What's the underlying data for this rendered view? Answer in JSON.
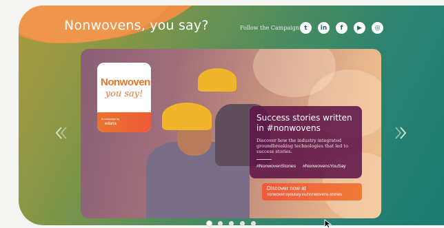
{
  "header": {
    "title": "Nonwovens, you say?",
    "follow_label": "Follow the Campaign",
    "socials": [
      {
        "icon": "twitter-icon",
        "glyph": "t"
      },
      {
        "icon": "linkedin-icon",
        "glyph": "in"
      },
      {
        "icon": "facebook-icon",
        "glyph": "f"
      },
      {
        "icon": "youtube-icon",
        "glyph": "▶"
      },
      {
        "icon": "instagram-icon",
        "glyph": "◎"
      }
    ]
  },
  "slide": {
    "logo": {
      "line1": "Nonwovens",
      "line2": "you say!",
      "small_line": "A campaign by",
      "brand": "edana"
    },
    "card": {
      "title": "Success stories written in #nonwovens",
      "body": "Discover how the industry integrated groundbreaking technologies that led to success stories.",
      "tags": [
        "#NonwovenStories",
        "#NonwovensYouSay"
      ]
    },
    "cta": {
      "line1": "Discover now at",
      "line2": "nonwovensyousay.eu/nonwovens-stories"
    }
  },
  "carousel": {
    "dots": 5,
    "active_index": 0
  },
  "colors": {
    "accent_orange": "#ea8d45",
    "panel_teal": "#1b7c74",
    "card_purple": "#5f1648",
    "cta_red": "#ef5a3a"
  }
}
